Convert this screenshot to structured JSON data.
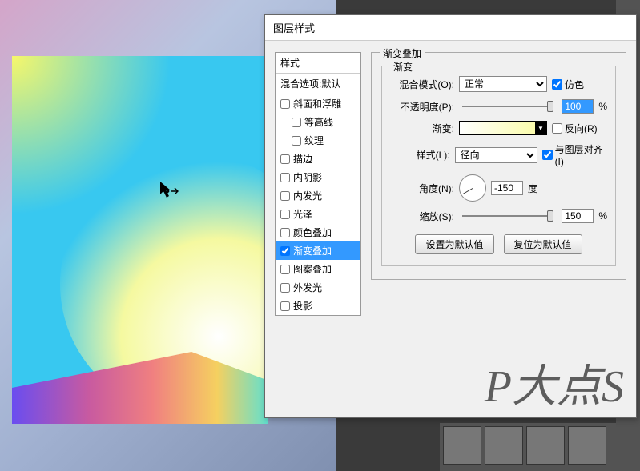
{
  "dialog": {
    "title": "图层样式",
    "styles_header": "样式",
    "blend_options": "混合选项:默认",
    "items": [
      {
        "label": "斜面和浮雕",
        "checked": false,
        "indent": false
      },
      {
        "label": "等高线",
        "checked": false,
        "indent": true
      },
      {
        "label": "纹理",
        "checked": false,
        "indent": true
      },
      {
        "label": "描边",
        "checked": false,
        "indent": false
      },
      {
        "label": "内阴影",
        "checked": false,
        "indent": false
      },
      {
        "label": "内发光",
        "checked": false,
        "indent": false
      },
      {
        "label": "光泽",
        "checked": false,
        "indent": false
      },
      {
        "label": "颜色叠加",
        "checked": false,
        "indent": false
      },
      {
        "label": "渐变叠加",
        "checked": true,
        "indent": false,
        "selected": true
      },
      {
        "label": "图案叠加",
        "checked": false,
        "indent": false
      },
      {
        "label": "外发光",
        "checked": false,
        "indent": false
      },
      {
        "label": "投影",
        "checked": false,
        "indent": false
      }
    ]
  },
  "panel": {
    "section_title": "渐变叠加",
    "subsection_title": "渐变",
    "blend_mode_label": "混合模式(O):",
    "blend_mode_value": "正常",
    "dither_label": "仿色",
    "dither_checked": true,
    "opacity_label": "不透明度(P):",
    "opacity_value": "100",
    "opacity_unit": "%",
    "gradient_label": "渐变:",
    "reverse_label": "反向(R)",
    "reverse_checked": false,
    "style_label": "样式(L):",
    "style_value": "径向",
    "align_label": "与图层对齐(I)",
    "align_checked": true,
    "angle_label": "角度(N):",
    "angle_value": "-150",
    "angle_unit": "度",
    "scale_label": "缩放(S):",
    "scale_value": "150",
    "scale_unit": "%",
    "btn_default": "设置为默认值",
    "btn_reset": "复位为默认值"
  },
  "watermark": "P大点S"
}
